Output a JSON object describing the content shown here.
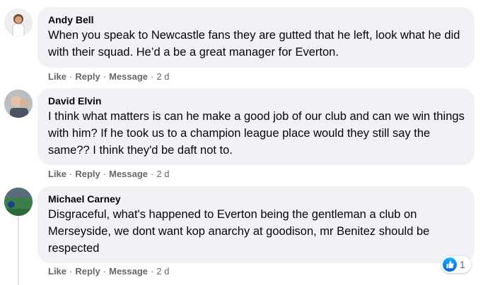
{
  "comments": [
    {
      "author": "Andy Bell",
      "text": "When you speak to Newcastle fans they are gutted that he left, look what he did with their squad. He’d a be a great manager for Everton.",
      "actions": {
        "like": "Like",
        "reply": "Reply",
        "message": "Message",
        "time": "2 d"
      }
    },
    {
      "author": "David Elvin",
      "text": "I think what matters is can he make a good job of our club and can we win things with him? If he took us to a champion league place would they still say the same?? I think they'd be daft not to.",
      "actions": {
        "like": "Like",
        "reply": "Reply",
        "message": "Message",
        "time": "2 d"
      }
    },
    {
      "author": "Michael Carney",
      "text": "Disgraceful, what's happened to Everton being the gentleman a club on Merseyside, we dont want kop anarchy at goodison, mr Benitez should be respected",
      "actions": {
        "like": "Like",
        "reply": "Reply",
        "message": "Message",
        "time": "2 d"
      },
      "reaction_count": "1",
      "reaction_icon": "like-icon"
    }
  ],
  "separator": "·",
  "colors": {
    "bubble_bg": "#f0f2f5",
    "secondary_text": "#65676b",
    "like_blue": "#1877f2"
  }
}
